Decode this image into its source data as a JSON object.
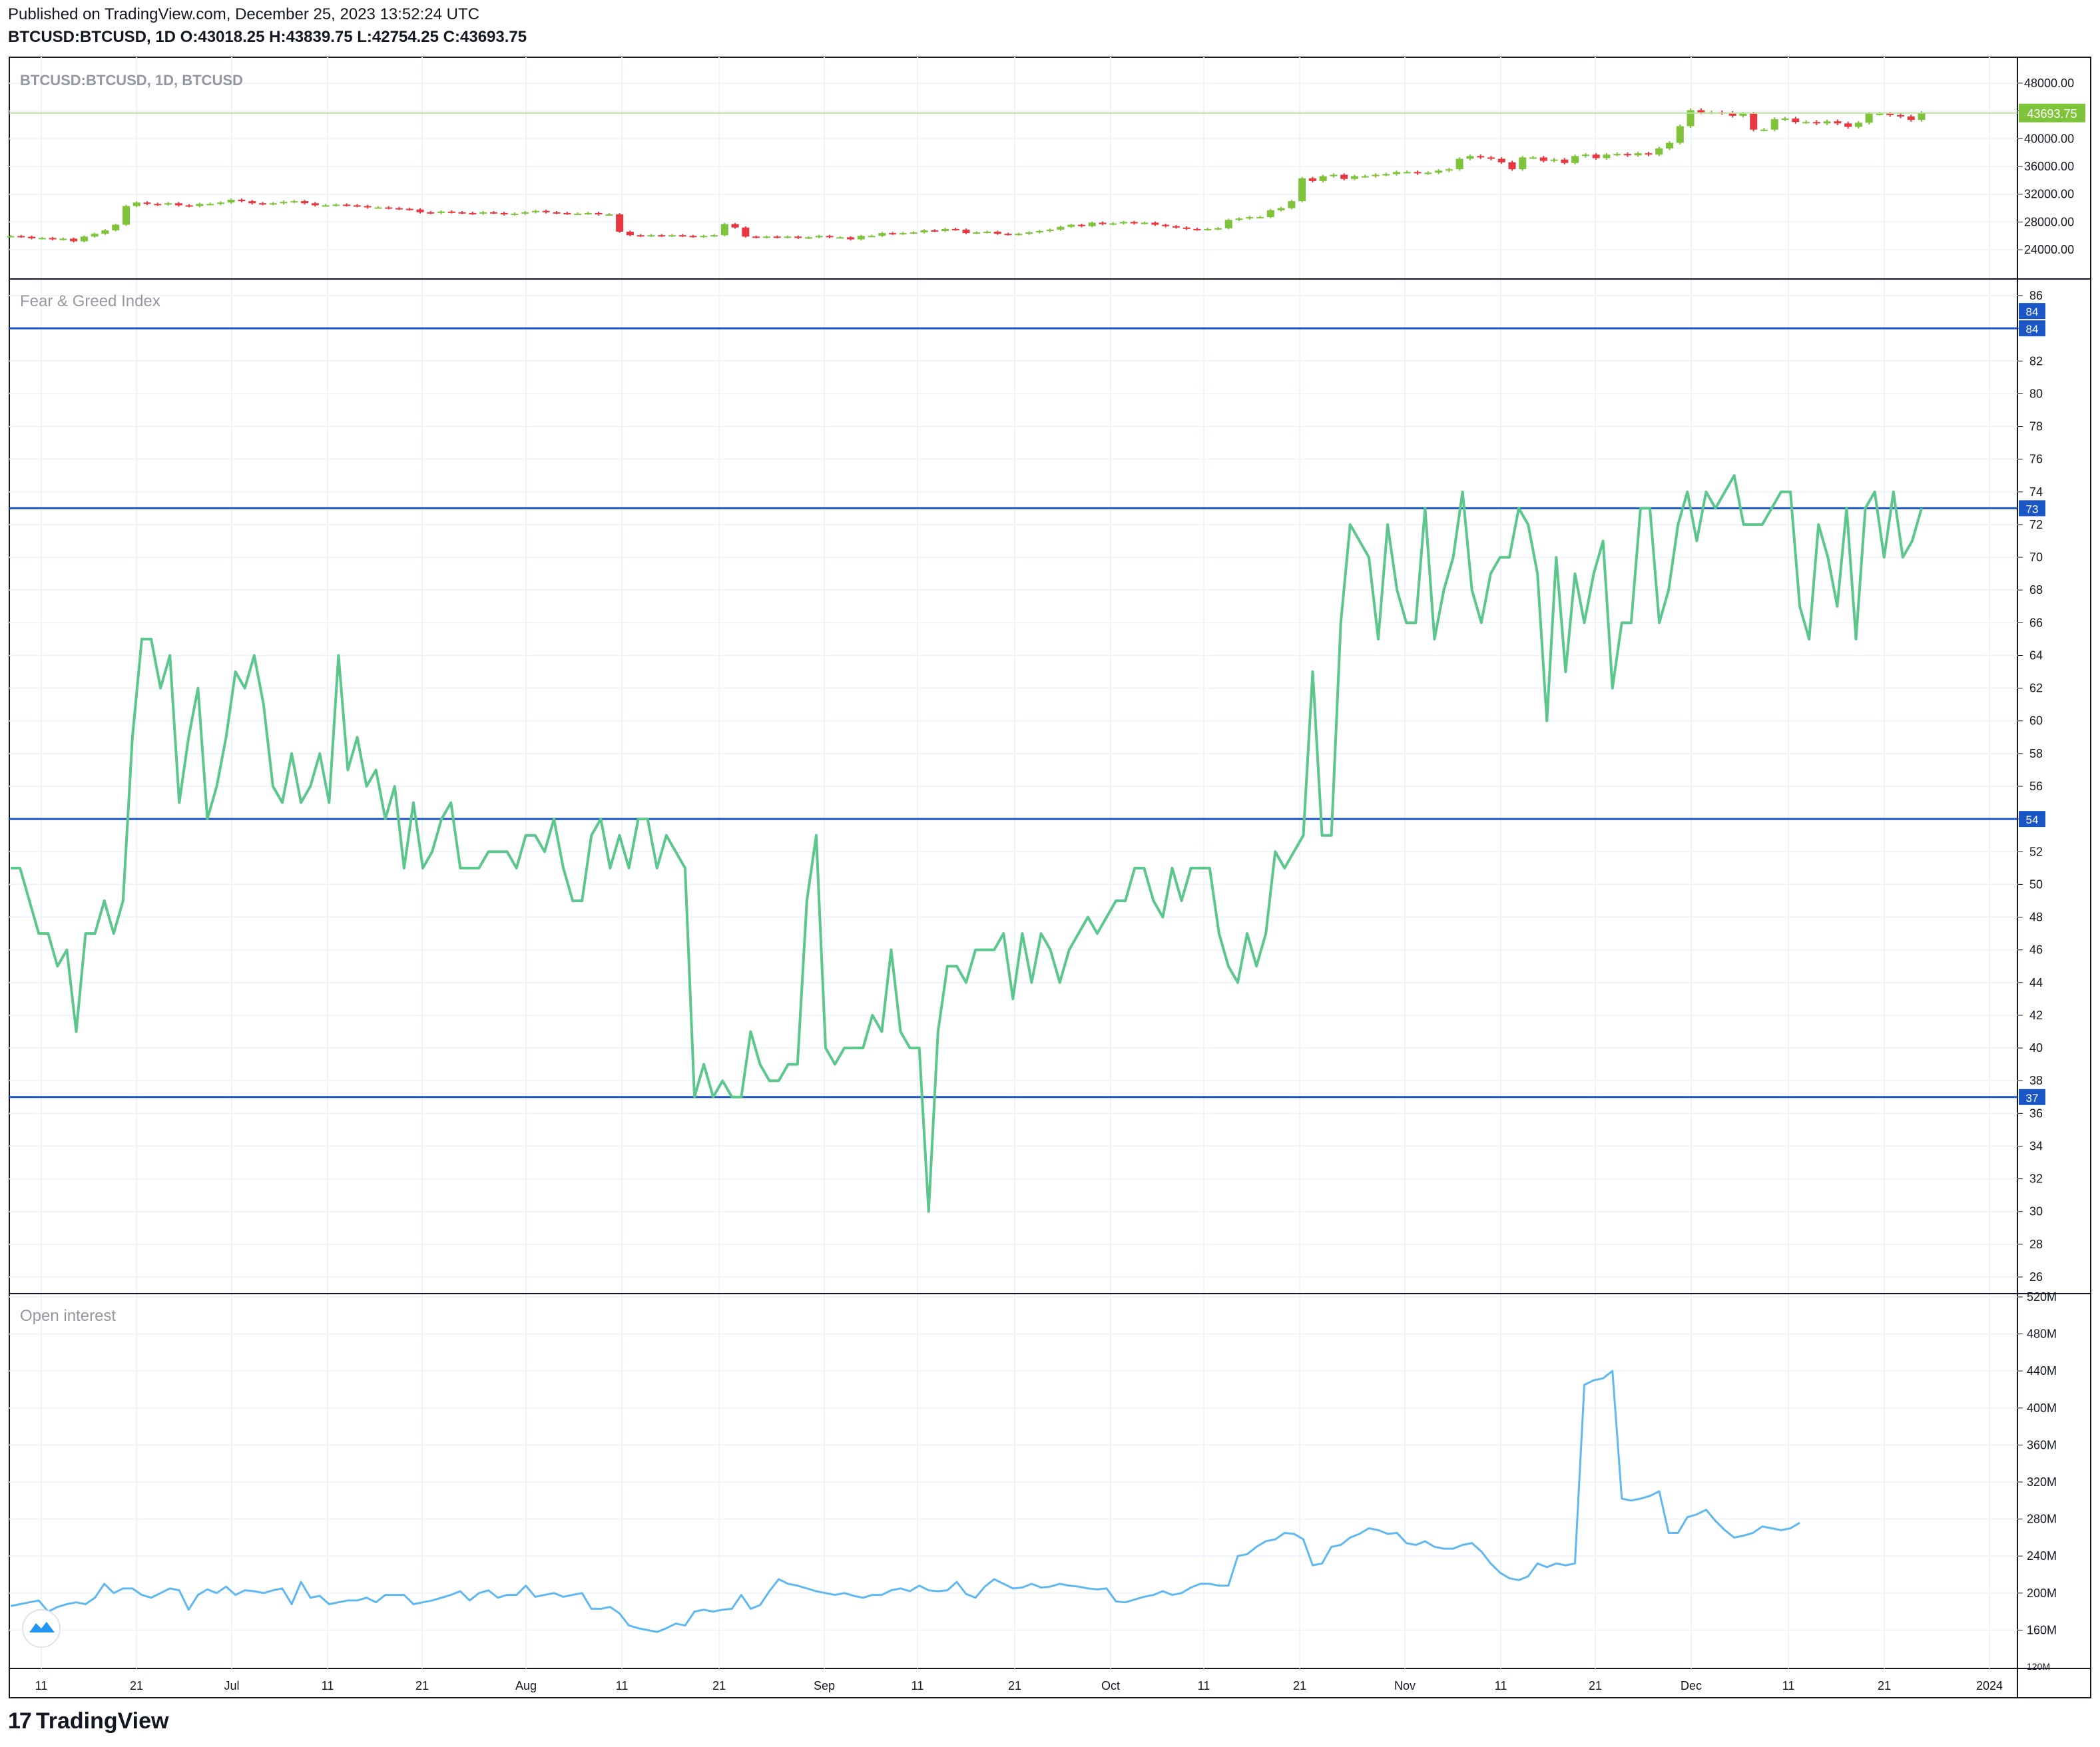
{
  "header": {
    "published": "Published on TradingView.com, December 25, 2023 13:52:24 UTC",
    "symbol": "BTCUSD:BTCUSD, 1D",
    "ohlc": {
      "o_label": "O:",
      "o": "43018.25",
      "h_label": "H:",
      "h": "43839.75",
      "l_label": "L:",
      "l": "42754.25",
      "c_label": "C:",
      "c": "43693.75"
    }
  },
  "brand": {
    "name": "TradingView",
    "logo_icon": "tradingview-logo-icon"
  },
  "colors": {
    "up": "#7ec33a",
    "down": "#e8373e",
    "fgi_line": "#5cc78c",
    "oi_line": "#5fb8ef",
    "hline": "#1a56c6",
    "price_tag": "#7ec33a",
    "grid": "#f0f3fa"
  },
  "chart_data": [
    {
      "type": "candlestick",
      "title": "BTCUSD:BTCUSD, 1D, BTCUSD",
      "ylim": [
        22000,
        50000
      ],
      "y_ticks": [
        "24000.00",
        "28000.00",
        "32000.00",
        "36000.00",
        "40000.00",
        "44000.00",
        "48000.00"
      ],
      "last_price_label": "43693.75",
      "last_price": 43693.75,
      "close": [
        25980,
        25880,
        25650,
        25700,
        25500,
        25600,
        25220,
        25900,
        26300,
        26800,
        27600,
        30300,
        30800,
        30600,
        30500,
        30700,
        30400,
        30300,
        30600,
        30600,
        30800,
        31200,
        31000,
        30700,
        30600,
        30700,
        30900,
        31000,
        30700,
        30400,
        30400,
        30500,
        30400,
        30300,
        30100,
        30100,
        30000,
        29900,
        29800,
        29400,
        29300,
        29500,
        29400,
        29300,
        29200,
        29400,
        29300,
        29100,
        29200,
        29400,
        29600,
        29400,
        29300,
        29200,
        29200,
        29300,
        29100,
        29100,
        26600,
        26100,
        26000,
        26100,
        26000,
        26100,
        26000,
        25900,
        26000,
        26100,
        27700,
        27200,
        25900,
        25800,
        25900,
        25800,
        25900,
        25700,
        25800,
        26000,
        25800,
        25800,
        25500,
        26000,
        26000,
        26400,
        26300,
        26400,
        26500,
        26800,
        26700,
        27000,
        26900,
        26400,
        26500,
        26600,
        26300,
        26200,
        26300,
        26500,
        26700,
        26900,
        27300,
        27600,
        27400,
        27900,
        27700,
        27800,
        28000,
        27800,
        27900,
        27600,
        27400,
        27200,
        27000,
        26900,
        27000,
        27100,
        28300,
        28500,
        28700,
        28700,
        29700,
        30000,
        31000,
        34300,
        33900,
        34600,
        34800,
        34200,
        34600,
        34600,
        34800,
        34900,
        35200,
        35200,
        35000,
        35100,
        35400,
        35600,
        37100,
        37500,
        37300,
        37100,
        36600,
        35600,
        37300,
        37300,
        36800,
        37000,
        36500,
        37500,
        37700,
        37200,
        37700,
        37800,
        37600,
        37900,
        37700,
        38600,
        39400,
        41800,
        44100,
        43800,
        43800,
        43700,
        43300,
        43600,
        41300,
        41300,
        42800,
        42900,
        42400,
        42400,
        42200,
        42500,
        42200,
        41700,
        42300,
        43600,
        43600,
        43400,
        43200,
        42700,
        43690
      ],
      "candle_note": "daily OHLC, approx. from mid-June 2023 to Dec 25 2023"
    },
    {
      "type": "line",
      "title": "Fear & Greed Index",
      "ylim": [
        25,
        86
      ],
      "y_ticks": [
        26,
        28,
        30,
        32,
        34,
        36,
        38,
        40,
        42,
        44,
        46,
        48,
        50,
        52,
        54,
        56,
        58,
        60,
        62,
        64,
        66,
        68,
        70,
        72,
        74,
        76,
        78,
        80,
        82,
        84,
        86
      ],
      "hlines": [
        84,
        73,
        54,
        37
      ],
      "hline_labels": [
        "84",
        "73",
        "54",
        "37"
      ],
      "top_label": "84",
      "series": [
        {
          "values": [
            51,
            51,
            49,
            47,
            47,
            45,
            46,
            41,
            47,
            47,
            49,
            47,
            49,
            59,
            65,
            65,
            62,
            64,
            55,
            59,
            62,
            54,
            56,
            59,
            63,
            62,
            64,
            61,
            56,
            55,
            58,
            55,
            56,
            58,
            55,
            64,
            57,
            59,
            56,
            57,
            54,
            56,
            51,
            55,
            51,
            52,
            54,
            55,
            51,
            51,
            51,
            52,
            52,
            52,
            51,
            53,
            53,
            52,
            54,
            51,
            49,
            49,
            53,
            54,
            51,
            53,
            51,
            54,
            54,
            51,
            53,
            52,
            51,
            37,
            39,
            37,
            38,
            37,
            37,
            41,
            39,
            38,
            38,
            39,
            39,
            49,
            53,
            40,
            39,
            40,
            40,
            40,
            42,
            41,
            46,
            41,
            40,
            40,
            30,
            41,
            45,
            45,
            44,
            46,
            46,
            46,
            47,
            43,
            47,
            44,
            47,
            46,
            44,
            46,
            47,
            48,
            47,
            48,
            49,
            49,
            51,
            51,
            49,
            48,
            51,
            49,
            51,
            51,
            51,
            47,
            45,
            44,
            47,
            45,
            47,
            52,
            51,
            52,
            53,
            63,
            53,
            53,
            66,
            72,
            71,
            70,
            65,
            72,
            68,
            66,
            66,
            73,
            65,
            68,
            70,
            74,
            68,
            66,
            69,
            70,
            70,
            73,
            72,
            69,
            60,
            70,
            63,
            69,
            66,
            69,
            71,
            62,
            66,
            66,
            73,
            73,
            66,
            68,
            72,
            74,
            71,
            74,
            73,
            74,
            75,
            72,
            72,
            72,
            73,
            74,
            74,
            67,
            65,
            72,
            70,
            67,
            73,
            65,
            73,
            74,
            70,
            74,
            70,
            71,
            73
          ]
        }
      ]
    },
    {
      "type": "line",
      "title": "Open interest",
      "ylim": [
        120,
        520
      ],
      "y_ticks": [
        "160M",
        "200M",
        "240M",
        "280M",
        "320M",
        "360M",
        "400M",
        "440M",
        "480M",
        "520M"
      ],
      "bottom_tick": "120M",
      "unit": "M",
      "series": [
        {
          "values": [
            186,
            188,
            190,
            192,
            180,
            185,
            188,
            190,
            188,
            195,
            210,
            200,
            205,
            205,
            198,
            195,
            200,
            205,
            203,
            182,
            198,
            204,
            200,
            207,
            198,
            203,
            202,
            200,
            203,
            205,
            188,
            212,
            195,
            197,
            188,
            190,
            192,
            192,
            195,
            190,
            198,
            198,
            198,
            188,
            190,
            192,
            195,
            198,
            202,
            192,
            200,
            203,
            195,
            198,
            198,
            208,
            196,
            198,
            200,
            196,
            198,
            200,
            183,
            183,
            185,
            178,
            165,
            162,
            160,
            158,
            162,
            167,
            165,
            180,
            182,
            180,
            182,
            183,
            198,
            183,
            187,
            202,
            215,
            210,
            208,
            205,
            202,
            200,
            198,
            200,
            197,
            195,
            198,
            198,
            203,
            205,
            202,
            208,
            203,
            202,
            203,
            212,
            199,
            195,
            207,
            215,
            210,
            205,
            206,
            210,
            206,
            207,
            210,
            208,
            207,
            205,
            204,
            205,
            191,
            190,
            193,
            196,
            198,
            202,
            198,
            200,
            206,
            210,
            210,
            208,
            208,
            240,
            242,
            250,
            256,
            258,
            265,
            264,
            258,
            230,
            232,
            250,
            252,
            260,
            264,
            270,
            268,
            264,
            265,
            254,
            252,
            256,
            250,
            248,
            248,
            252,
            254,
            245,
            232,
            222,
            216,
            214,
            218,
            232,
            228,
            232,
            230,
            232,
            425,
            430,
            432,
            440,
            302,
            300,
            302,
            305,
            310,
            265,
            265,
            282,
            285,
            290,
            278,
            268,
            260,
            262,
            265,
            272,
            270,
            268,
            270,
            276
          ]
        }
      ]
    }
  ],
  "x_axis": {
    "labels": [
      "11",
      "21",
      "Jul",
      "11",
      "21",
      "Aug",
      "11",
      "21",
      "Sep",
      "11",
      "21",
      "Oct",
      "11",
      "21",
      "Nov",
      "11",
      "21",
      "Dec",
      "11",
      "21",
      "2024"
    ]
  }
}
